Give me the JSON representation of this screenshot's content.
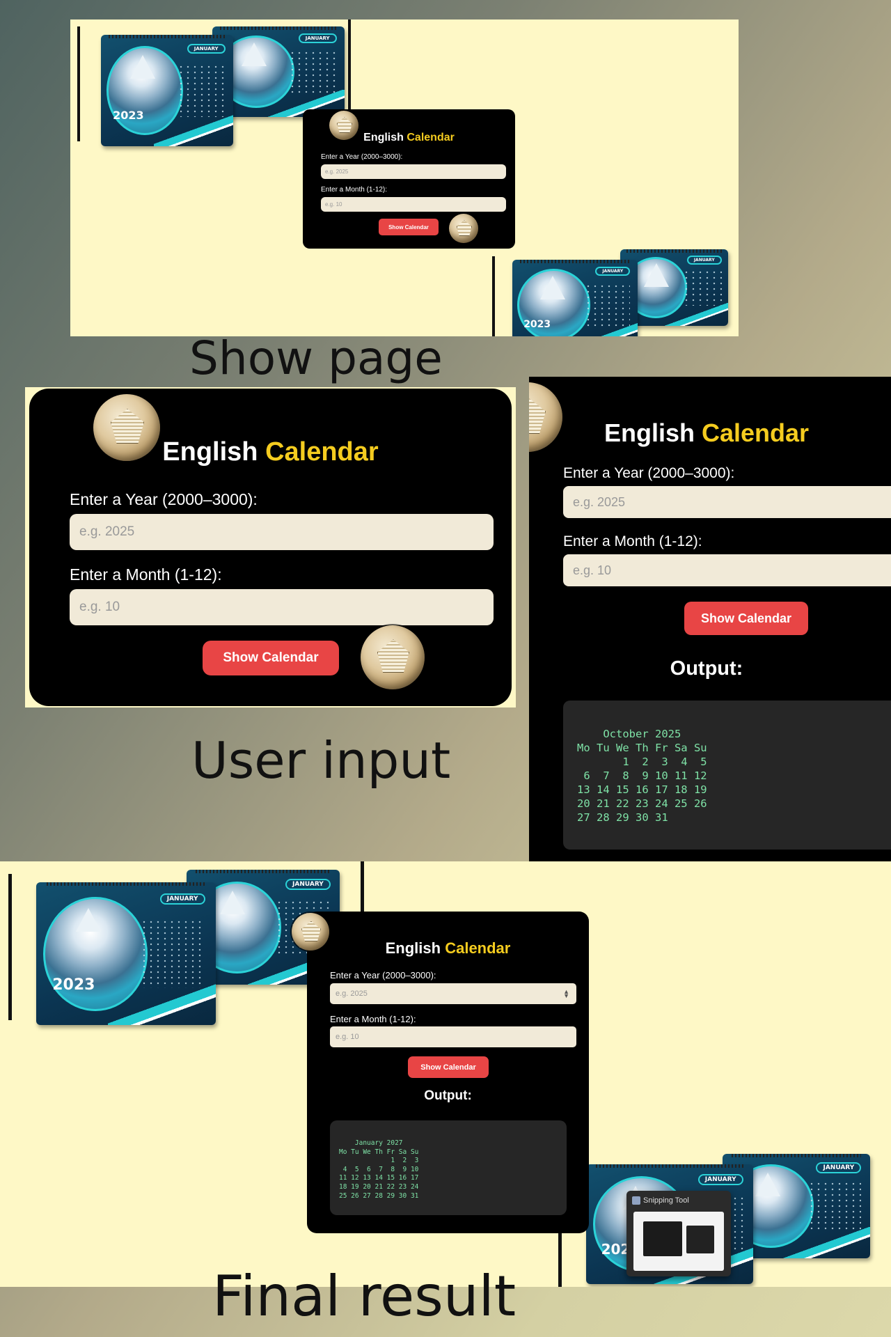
{
  "captions": {
    "show_page": "Show page",
    "user_input": "User input",
    "final_result": "Final result"
  },
  "calendar_app": {
    "title_first": "English",
    "title_second": "Calendar",
    "year_label": "Enter a Year (2000–3000):",
    "year_placeholder": "e.g. 2025",
    "month_label": "Enter a Month (1-12):",
    "month_placeholder": "e.g. 10",
    "button_label": "Show Calendar",
    "output_heading": "Output:"
  },
  "outputs": {
    "october_2025": "    October 2025\nMo Tu We Th Fr Sa Su\n       1  2  3  4  5\n 6  7  8  9 10 11 12\n13 14 15 16 17 18 19\n20 21 22 23 24 25 26\n27 28 29 30 31",
    "january_2027": "    January 2027\nMo Tu We Th Fr Sa Su\n             1  2  3\n 4  5  6  7  8  9 10\n11 12 13 14 15 16 17\n18 19 20 21 22 23 24\n25 26 27 28 29 30 31"
  },
  "desk_calendar": {
    "year": "2023",
    "month": "JANUARY"
  },
  "snipping_tool": {
    "title": "Snipping Tool"
  },
  "colors": {
    "accent": "#f5cc1f",
    "button": "#e84545",
    "panel": "#000000",
    "input": "#f1ead8",
    "output_text": "#7fe3a7",
    "page_bg": "#fef8c6"
  }
}
